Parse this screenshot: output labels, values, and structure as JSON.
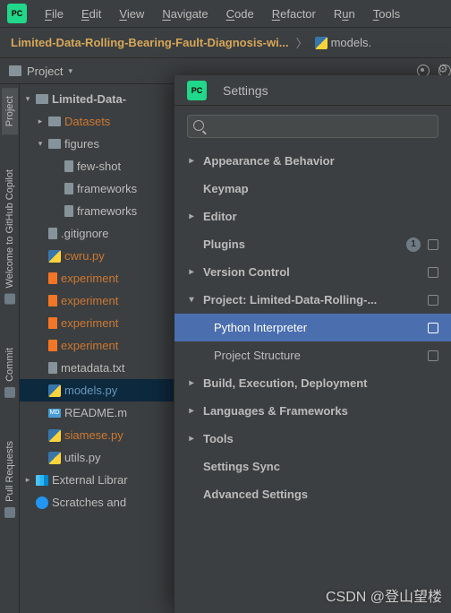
{
  "menu": {
    "file": "File",
    "edit": "Edit",
    "view": "View",
    "navigate": "Navigate",
    "code": "Code",
    "refactor": "Refactor",
    "run": "Run",
    "tools": "Tools"
  },
  "breadcrumb": {
    "project": "Limited-Data-Rolling-Bearing-Fault-Diagnosis-wi...",
    "file": "models."
  },
  "toolstrip": {
    "project_label": "Project"
  },
  "gutter": {
    "project": "Project",
    "copilot": "Welcome to GitHub Copilot",
    "commit": "Commit",
    "pull": "Pull Requests"
  },
  "tree": {
    "root": "Limited-Data-",
    "datasets": "Datasets",
    "figures": "figures",
    "fig_items": [
      "few-shot",
      "frameworks",
      "frameworks"
    ],
    "gitignore": ".gitignore",
    "cwru": "cwru.py",
    "exp": "experiment",
    "metadata": "metadata.txt",
    "models": "models.py",
    "readme": "README.m",
    "siamese": "siamese.py",
    "utils": "utils.py",
    "extlib": "External Librar",
    "scratches": "Scratches and"
  },
  "settings": {
    "title": "Settings",
    "search_placeholder": "",
    "items": {
      "appearance": "Appearance & Behavior",
      "keymap": "Keymap",
      "editor": "Editor",
      "plugins": "Plugins",
      "plugins_badge": "1",
      "vcs": "Version Control",
      "project": "Project: Limited-Data-Rolling-...",
      "interpreter": "Python Interpreter",
      "structure": "Project Structure",
      "build": "Build, Execution, Deployment",
      "lang": "Languages & Frameworks",
      "tools": "Tools",
      "sync": "Settings Sync",
      "advanced": "Advanced Settings"
    }
  },
  "watermark": "CSDN @登山望楼"
}
